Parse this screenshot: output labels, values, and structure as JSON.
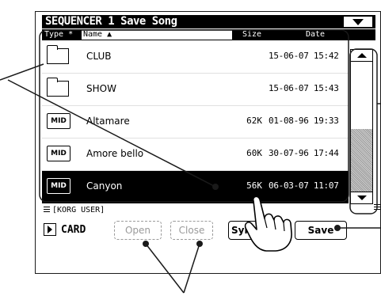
{
  "header": {
    "title": "SEQUENCER 1  Save Song"
  },
  "columns": {
    "type": "Type *",
    "name": "Name ▲",
    "size": "Size",
    "date": "Date"
  },
  "files": [
    {
      "icon": "folder-icon",
      "name": "CLUB",
      "size": "",
      "date": "15-06-07 15:42"
    },
    {
      "icon": "folder-icon",
      "name": "SHOW",
      "size": "",
      "date": "15-06-07 15:43"
    },
    {
      "icon": "midi-file-icon",
      "icon_text": "MID",
      "name": "Altamare",
      "size": "62K",
      "date": "01-08-96 19:33"
    },
    {
      "icon": "midi-file-icon",
      "icon_text": "MID",
      "name": "Amore bello",
      "size": "60K",
      "date": "30-07-96 17:44"
    },
    {
      "icon": "midi-file-icon",
      "icon_text": "MID",
      "name": "Canyon",
      "size": "56K",
      "date": "06-03-07 11:07",
      "selected": true
    }
  ],
  "scrollbar": {
    "thumb_start": 0.52,
    "thumb_end": 1.0
  },
  "path": {
    "label": "[KORG USER]"
  },
  "device": {
    "label": "CARD"
  },
  "buttons": {
    "open": "Open",
    "close": "Close",
    "sync": "Syn",
    "save": "Save"
  },
  "colors": {
    "callout": "#1a1a1a",
    "selected_row": "#000000",
    "disabled": "#9a9a9a"
  }
}
